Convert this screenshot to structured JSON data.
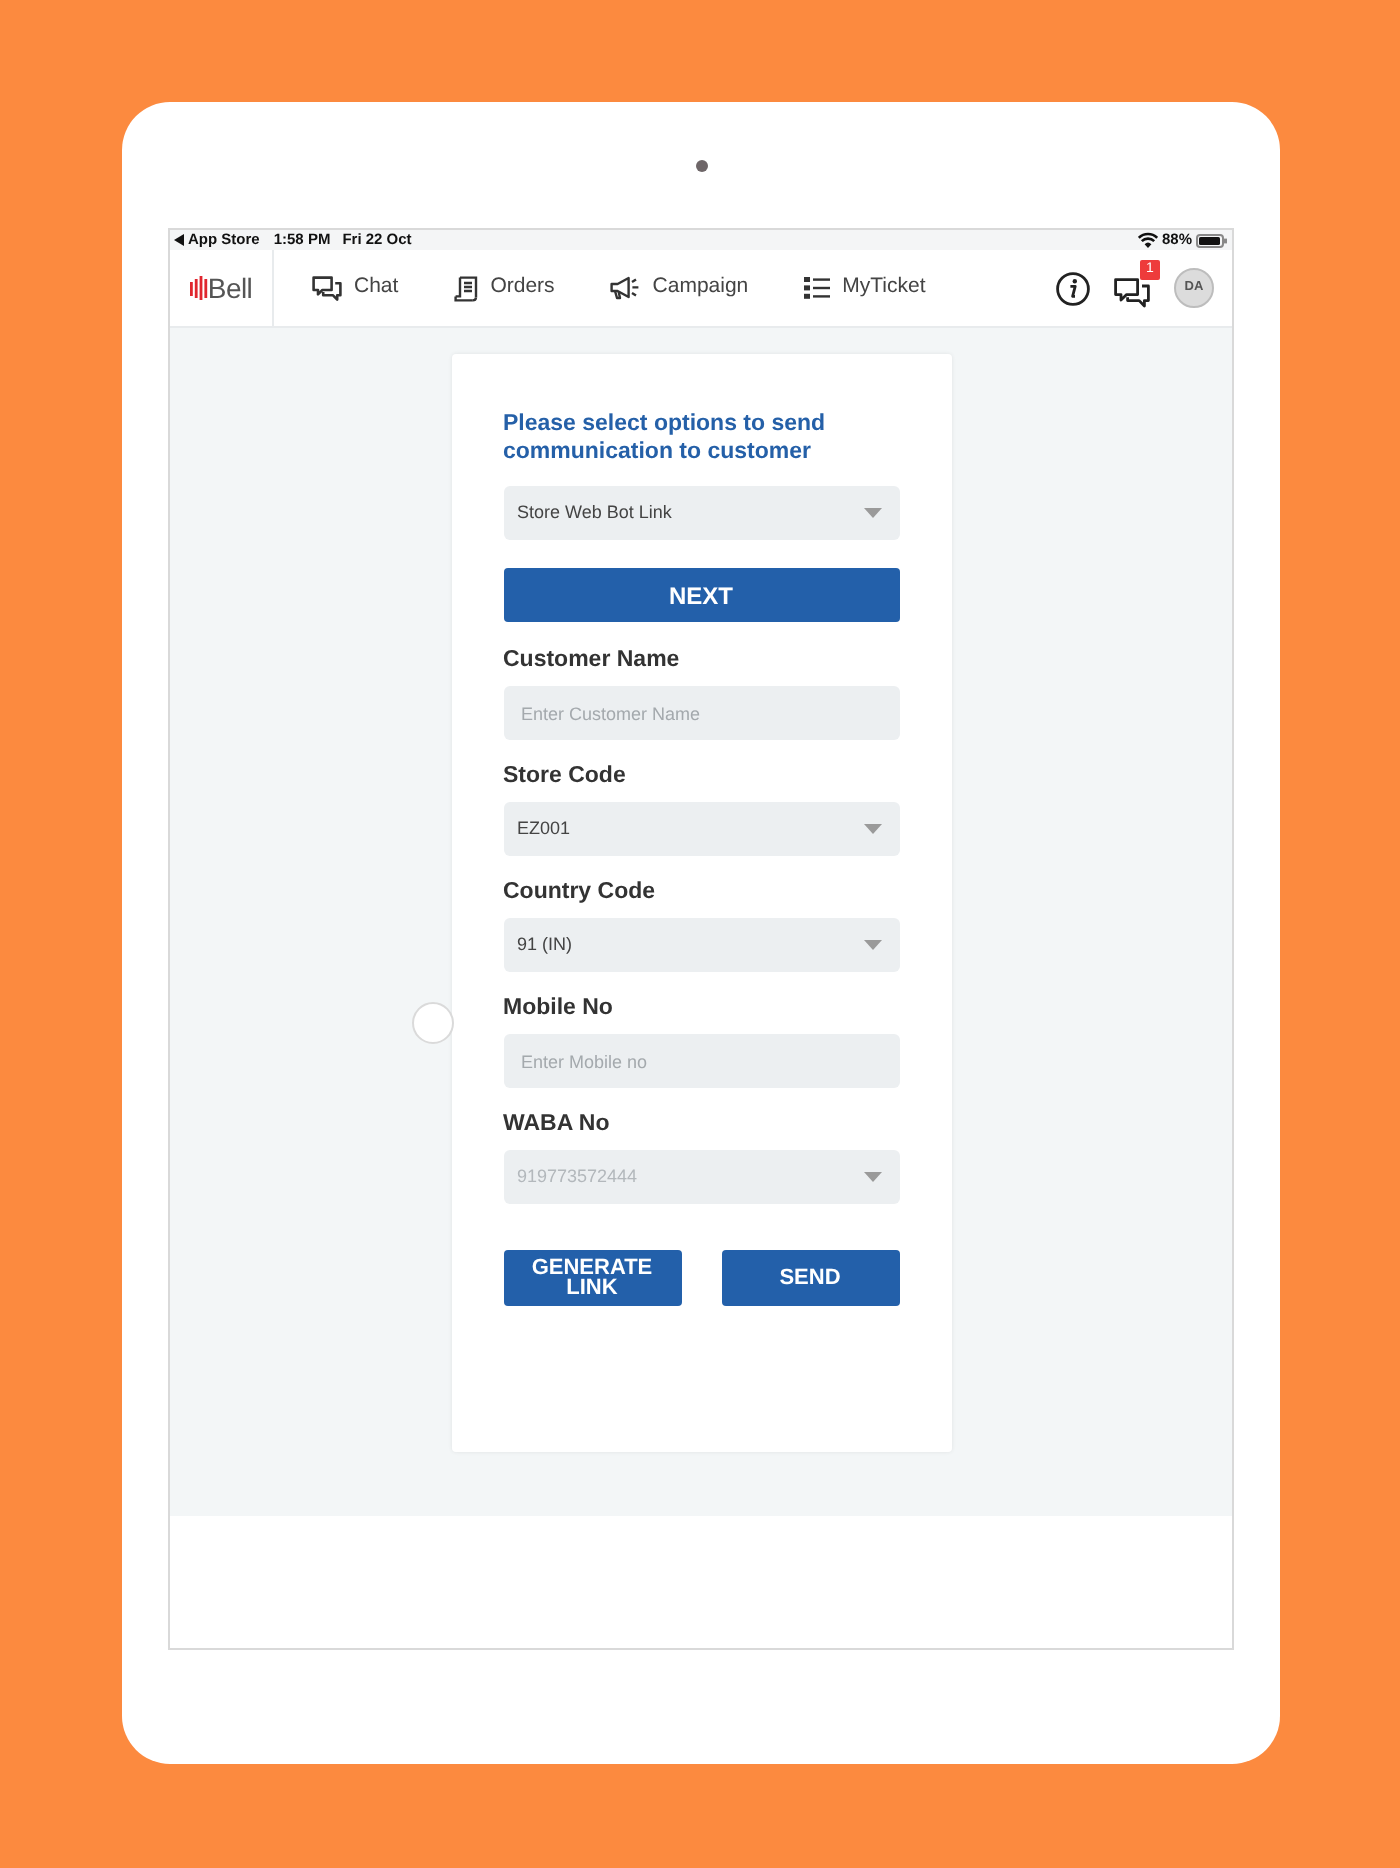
{
  "status_bar": {
    "back_label": "App Store",
    "time": "1:58 PM",
    "date": "Fri 22 Oct",
    "battery": "88%"
  },
  "nav": {
    "logo": "Bell",
    "items": [
      {
        "kind": "chat",
        "label": "Chat"
      },
      {
        "kind": "orders",
        "label": "Orders"
      },
      {
        "kind": "campaign",
        "label": "Campaign"
      },
      {
        "kind": "ticket",
        "label": "MyTicket"
      }
    ],
    "notification_count": "1",
    "avatar": "DA"
  },
  "form": {
    "heading": "Please select options to send communication to customer",
    "items": [
      {
        "kind": "select",
        "value": "Store Web Bot Link",
        "disabled": false
      },
      {
        "kind": "button",
        "label": "NEXT",
        "disabled": false
      },
      {
        "kind": "input",
        "label": "Customer Name",
        "placeholder": "Enter Customer Name",
        "disabled": false
      },
      {
        "kind": "select",
        "label": "Store Code",
        "value": "EZ001",
        "disabled": false
      },
      {
        "kind": "select",
        "label": "Country Code",
        "value": "91 (IN)",
        "disabled": false
      },
      {
        "kind": "input",
        "label": "Mobile No",
        "placeholder": "Enter Mobile no",
        "disabled": false
      },
      {
        "kind": "select",
        "label": "WABA No",
        "value": "919773572444",
        "disabled": true
      }
    ],
    "buttons": [
      {
        "label": "GENERATE LINK"
      },
      {
        "label": "SEND"
      }
    ]
  }
}
